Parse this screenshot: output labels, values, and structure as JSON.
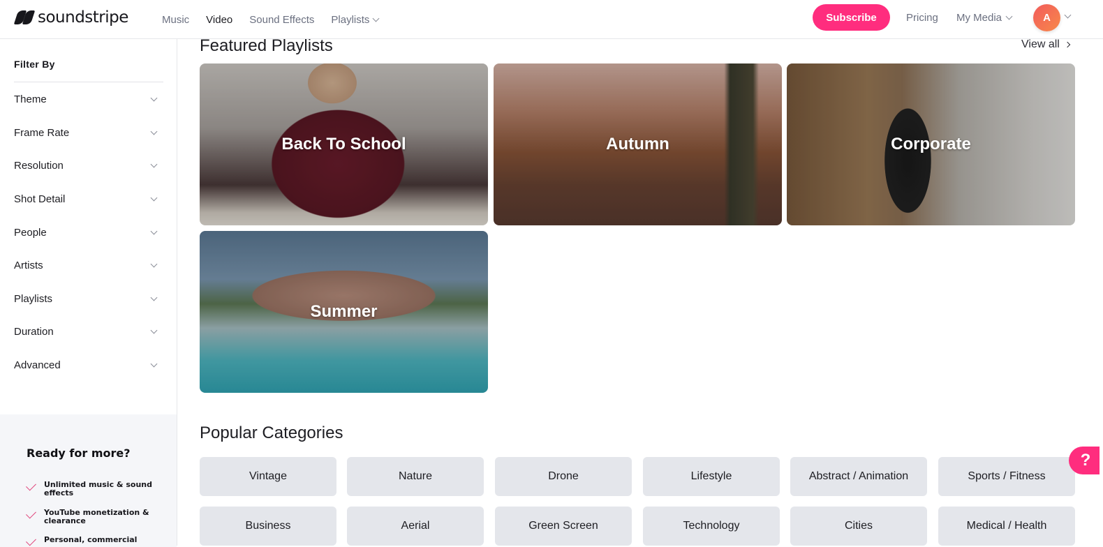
{
  "header": {
    "logo_text": "soundstripe",
    "nav": [
      {
        "label": "Music",
        "active": false
      },
      {
        "label": "Video",
        "active": true
      },
      {
        "label": "Sound Effects",
        "active": false
      },
      {
        "label": "Playlists",
        "active": false,
        "dropdown": true
      }
    ],
    "subscribe_label": "Subscribe",
    "pricing_label": "Pricing",
    "my_media_label": "My Media",
    "avatar_initial": "A",
    "accent_color": "#ff2d7e"
  },
  "sidebar": {
    "filter_title": "Filter By",
    "filters": [
      "Theme",
      "Frame Rate",
      "Resolution",
      "Shot Detail",
      "People",
      "Artists",
      "Playlists",
      "Duration",
      "Advanced"
    ],
    "promo": {
      "title": "Ready for more?",
      "items": [
        "Unlimited music & sound effects",
        "YouTube monetization & clearance",
        "Personal, commercial"
      ]
    }
  },
  "featured": {
    "title": "Featured Playlists",
    "view_all_label": "View all",
    "playlists": [
      "Back To School",
      "Autumn",
      "Corporate",
      "Summer"
    ]
  },
  "categories": {
    "title": "Popular Categories",
    "items": [
      "Vintage",
      "Nature",
      "Drone",
      "Lifestyle",
      "Abstract / Animation",
      "Sports / Fitness",
      "Business",
      "Aerial",
      "Green Screen",
      "Technology",
      "Cities",
      "Medical / Health"
    ]
  },
  "help_button_label": "?"
}
